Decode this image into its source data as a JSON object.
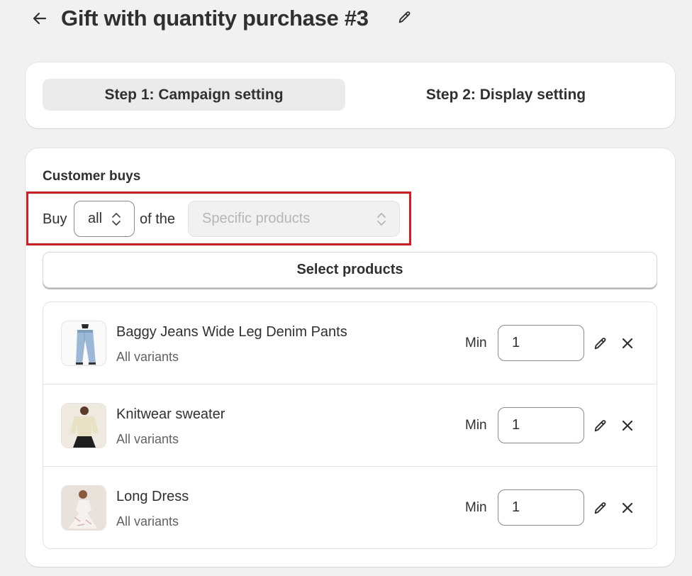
{
  "header": {
    "title": "Gift with quantity purchase #3",
    "back_icon": "arrow-left-icon",
    "edit_icon": "pencil-icon"
  },
  "steps": [
    {
      "label": "Step 1: Campaign setting",
      "active": true
    },
    {
      "label": "Step 2: Display setting",
      "active": false
    }
  ],
  "customer_buys": {
    "title": "Customer buys",
    "buy_label": "Buy",
    "buy_value": "all",
    "of_label": "of the",
    "scope_placeholder": "Specific products",
    "select_button": "Select products"
  },
  "products": [
    {
      "name": "Baggy Jeans Wide Leg Denim Pants",
      "variant": "All variants",
      "min_label": "Min",
      "min_value": "1"
    },
    {
      "name": "Knitwear sweater",
      "variant": "All variants",
      "min_label": "Min",
      "min_value": "1"
    },
    {
      "name": "Long Dress",
      "variant": "All variants",
      "min_label": "Min",
      "min_value": "1"
    }
  ],
  "colors": {
    "highlight": "#e8141a",
    "background": "#f1f1f1",
    "active_tab": "#ebebeb"
  }
}
